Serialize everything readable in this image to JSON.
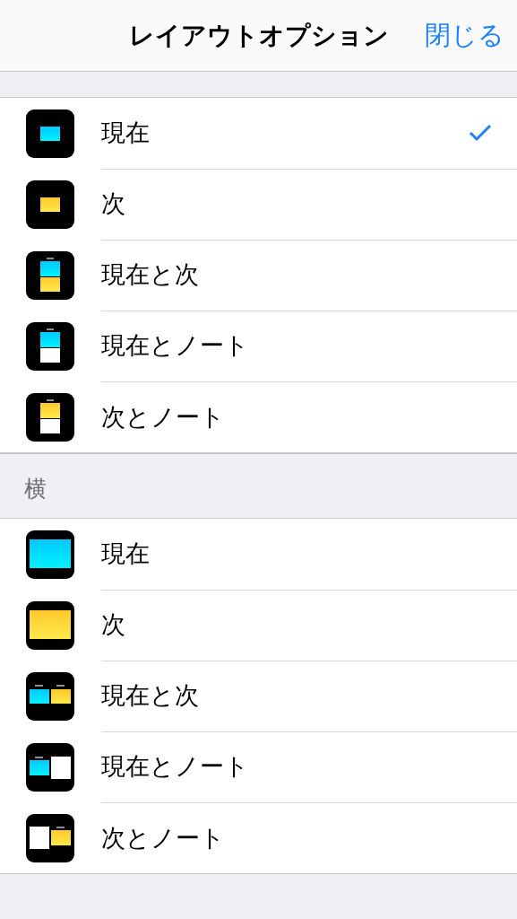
{
  "nav_bar": {
    "title": "レイアウトオプション",
    "close_button": "閉じる"
  },
  "sections": [
    {
      "kind": "portrait",
      "rows": [
        {
          "label": "現在",
          "kind": "current",
          "selected": true
        },
        {
          "label": "次",
          "kind": "next",
          "selected": false
        },
        {
          "label": "現在と次",
          "kind": "current_next",
          "selected": false
        },
        {
          "label": "現在とノート",
          "kind": "current_notes",
          "selected": false
        },
        {
          "label": "次とノート",
          "kind": "next_notes",
          "selected": false
        }
      ]
    },
    {
      "kind": "landscape",
      "header": "横",
      "rows": [
        {
          "label": "現在",
          "kind": "current",
          "selected": false
        },
        {
          "label": "次",
          "kind": "next",
          "selected": false
        },
        {
          "label": "現在と次",
          "kind": "current_next",
          "selected": false
        },
        {
          "label": "現在とノート",
          "kind": "current_notes",
          "selected": false
        },
        {
          "label": "次とノート",
          "kind": "next_notes",
          "selected": false
        }
      ]
    }
  ]
}
